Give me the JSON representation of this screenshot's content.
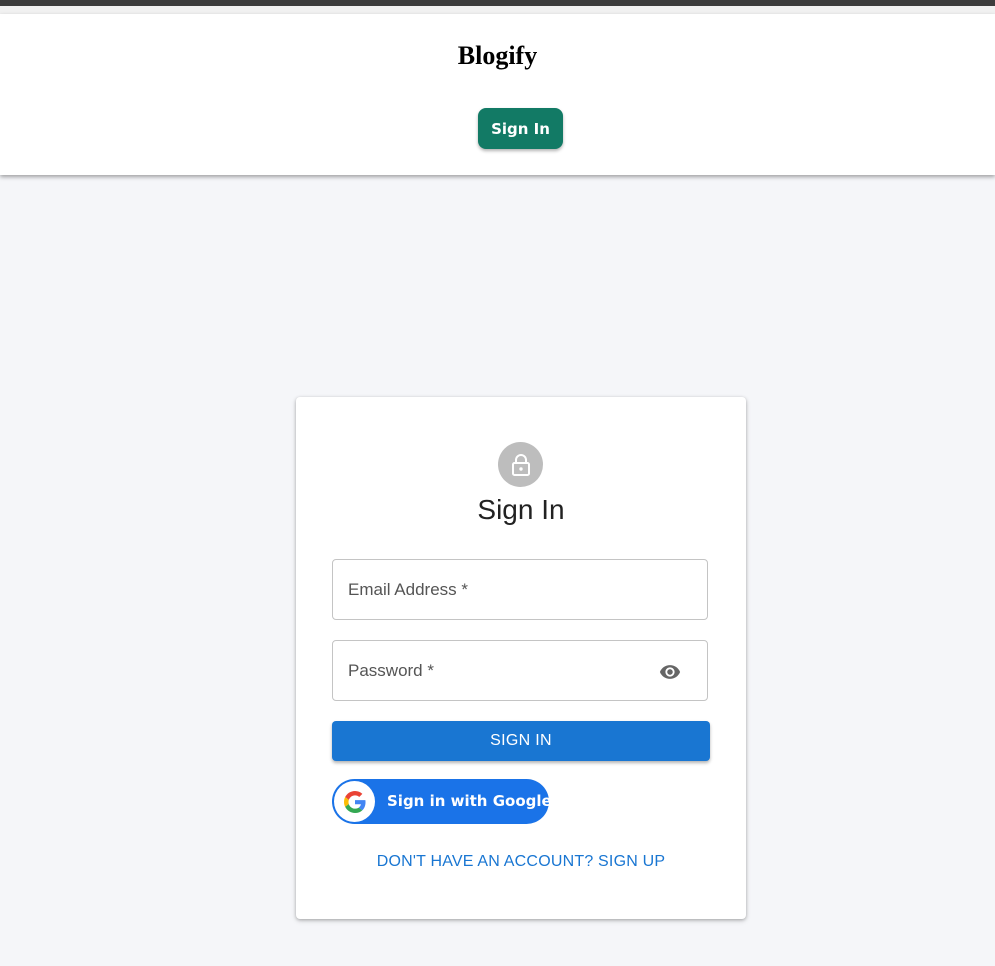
{
  "header": {
    "brand": "Blogify",
    "signin_label": "Sign In",
    "signin_color": "#127a65"
  },
  "card": {
    "title": "Sign In",
    "avatar_icon": "lock-icon",
    "email": {
      "placeholder": "Email Address *",
      "value": ""
    },
    "password": {
      "placeholder": "Password *",
      "value": "",
      "toggle_icon": "eye-icon"
    },
    "submit_label": "SIGN IN",
    "submit_color": "#1976d2",
    "google_label": "Sign in with Google",
    "google_icon": "google-logo-icon",
    "signup_link": "DON'T HAVE AN ACCOUNT? SIGN UP"
  }
}
